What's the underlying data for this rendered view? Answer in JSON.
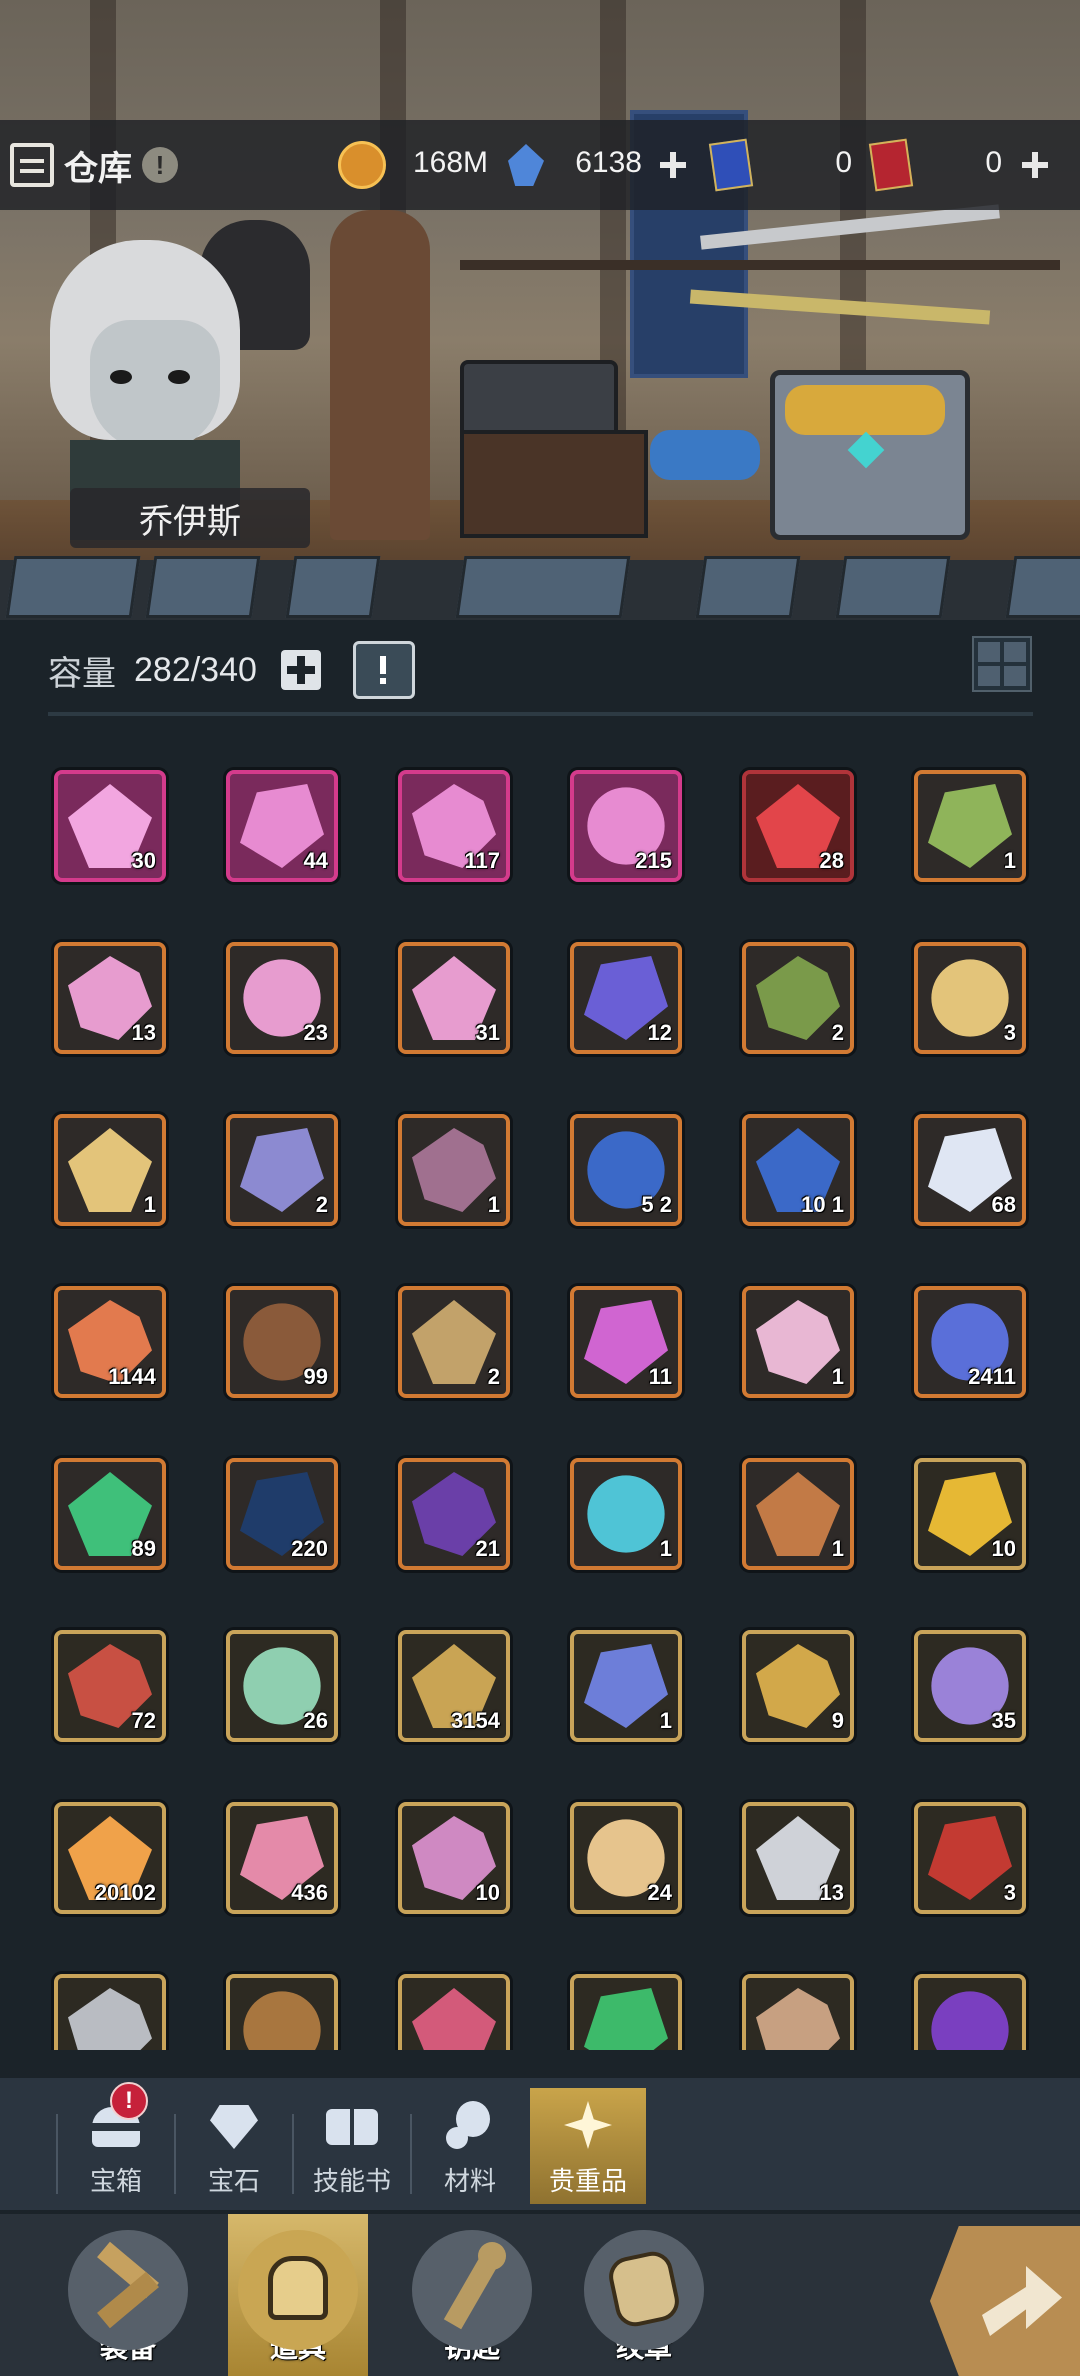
{
  "header": {
    "title": "仓库",
    "info_icon": "!",
    "resources": [
      {
        "name": "gold-coin-icon",
        "value": "168M",
        "has_plus": false
      },
      {
        "name": "blue-crystal-icon",
        "value": "6138",
        "has_plus": true
      },
      {
        "name": "blue-ticket-icon",
        "value": "0",
        "has_plus": false
      },
      {
        "name": "red-ticket-icon",
        "value": "0",
        "has_plus": true
      }
    ]
  },
  "hero": {
    "name": "乔伊斯"
  },
  "capacity": {
    "label": "容量",
    "value": "282/340"
  },
  "items": [
    {
      "icon": "pink-crystal-cluster-icon",
      "rarity": "pink",
      "qty": "30"
    },
    {
      "icon": "pink-crystal-sword-icon",
      "rarity": "pink",
      "qty": "44"
    },
    {
      "icon": "pink-crystal-ring-icon",
      "rarity": "pink",
      "qty": "117"
    },
    {
      "icon": "pink-crystal-armor-icon",
      "rarity": "pink",
      "qty": "215"
    },
    {
      "icon": "red-crystal-icon",
      "rarity": "red",
      "qty": "28"
    },
    {
      "icon": "green-vine-icon",
      "rarity": "orange",
      "qty": "1"
    },
    {
      "icon": "crystal-sword-icon",
      "rarity": "orange",
      "qty": "13"
    },
    {
      "icon": "crystal-ring-icon",
      "rarity": "orange",
      "qty": "23"
    },
    {
      "icon": "crystal-armor-icon",
      "rarity": "orange",
      "qty": "31"
    },
    {
      "icon": "purple-portal-ticket-icon",
      "rarity": "orange",
      "qty": "12"
    },
    {
      "icon": "green-staff-icon",
      "rarity": "orange",
      "qty": "2"
    },
    {
      "icon": "gold-scroll-icon",
      "rarity": "orange",
      "qty": "3"
    },
    {
      "icon": "gold-scroll-icon",
      "rarity": "orange",
      "qty": "1"
    },
    {
      "icon": "purple-staff-icon",
      "rarity": "orange",
      "qty": "2"
    },
    {
      "icon": "mushroom-icon",
      "rarity": "orange",
      "qty": "1"
    },
    {
      "icon": "star-ticket-icon",
      "rarity": "orange",
      "qty": "5 2"
    },
    {
      "icon": "star-ticket-icon",
      "rarity": "orange",
      "qty": "10 1"
    },
    {
      "icon": "angel-wing-icon",
      "rarity": "orange",
      "qty": "68"
    },
    {
      "icon": "copper-ore-icon",
      "rarity": "orange",
      "qty": "1144"
    },
    {
      "icon": "seed-bag-icon",
      "rarity": "orange",
      "qty": "99"
    },
    {
      "icon": "emblem-crest-icon",
      "rarity": "orange",
      "qty": "2"
    },
    {
      "icon": "purple-gem-icon",
      "rarity": "orange",
      "qty": "11"
    },
    {
      "icon": "flower-scroll-icon",
      "rarity": "orange",
      "qty": "1"
    },
    {
      "icon": "paw-crystal-icon",
      "rarity": "orange",
      "qty": "2411"
    },
    {
      "icon": "green-potion-icon",
      "rarity": "orange",
      "qty": "89"
    },
    {
      "icon": "dark-crystal-icon",
      "rarity": "orange",
      "qty": "220"
    },
    {
      "icon": "hourglass-icon",
      "rarity": "orange",
      "qty": "21"
    },
    {
      "icon": "crystal-orb-icon",
      "rarity": "orange",
      "qty": "1"
    },
    {
      "icon": "gear-dice-icon",
      "rarity": "orange",
      "qty": "1"
    },
    {
      "icon": "gold-nugget-icon",
      "rarity": "gold",
      "qty": "10"
    },
    {
      "icon": "red-flask-icon",
      "rarity": "gold",
      "qty": "72"
    },
    {
      "icon": "green-ticket-icon",
      "rarity": "gold",
      "qty": "26"
    },
    {
      "icon": "gold-shield-icon",
      "rarity": "gold",
      "qty": "3154"
    },
    {
      "icon": "blue-scroll-icon",
      "rarity": "gold",
      "qty": "1"
    },
    {
      "icon": "gold-key-icon",
      "rarity": "gold",
      "qty": "9"
    },
    {
      "icon": "purple-star-icon",
      "rarity": "gold",
      "qty": "35"
    },
    {
      "icon": "orange-star-gem-icon",
      "rarity": "gold",
      "qty": "20102"
    },
    {
      "icon": "pink-cookie-icon",
      "rarity": "gold",
      "qty": "436"
    },
    {
      "icon": "candy-icon",
      "rarity": "gold",
      "qty": "10"
    },
    {
      "icon": "parchment-icon",
      "rarity": "gold",
      "qty": "24"
    },
    {
      "icon": "thread-spool-icon",
      "rarity": "gold",
      "qty": "13"
    },
    {
      "icon": "red-cloth-icon",
      "rarity": "gold",
      "qty": "3"
    },
    {
      "icon": "iron-ingot-icon",
      "rarity": "gold",
      "qty": ""
    },
    {
      "icon": "leather-icon",
      "rarity": "gold",
      "qty": ""
    },
    {
      "icon": "crystal-chunk-icon",
      "rarity": "gold",
      "qty": ""
    },
    {
      "icon": "green-bottle-icon",
      "rarity": "gold",
      "qty": ""
    },
    {
      "icon": "pouch-icon",
      "rarity": "gold",
      "qty": ""
    },
    {
      "icon": "purple-flame-icon",
      "rarity": "gold",
      "qty": ""
    }
  ],
  "subtabs": [
    {
      "label": "宝箱",
      "icon": "chest-icon",
      "badge": "!",
      "active": false
    },
    {
      "label": "宝石",
      "icon": "gem-icon",
      "badge": "",
      "active": false
    },
    {
      "label": "技能书",
      "icon": "book-icon",
      "badge": "",
      "active": false
    },
    {
      "label": "材料",
      "icon": "materials-icon",
      "badge": "",
      "active": false
    },
    {
      "label": "贵重品",
      "icon": "valuables-icon",
      "badge": "",
      "active": true
    }
  ],
  "maintabs": [
    {
      "label": "装备",
      "icon": "equipment-icon",
      "active": false
    },
    {
      "label": "道具",
      "icon": "items-icon",
      "active": true
    },
    {
      "label": "钥匙",
      "icon": "key-icon",
      "active": false
    },
    {
      "label": "纹章",
      "icon": "crest-icon",
      "active": false
    }
  ],
  "colors": {
    "pink": "#d43b8c",
    "red": "#b0343a",
    "orange": "#d27a33",
    "gold": "#c9a45a",
    "active_tab": "#c9a44a"
  }
}
